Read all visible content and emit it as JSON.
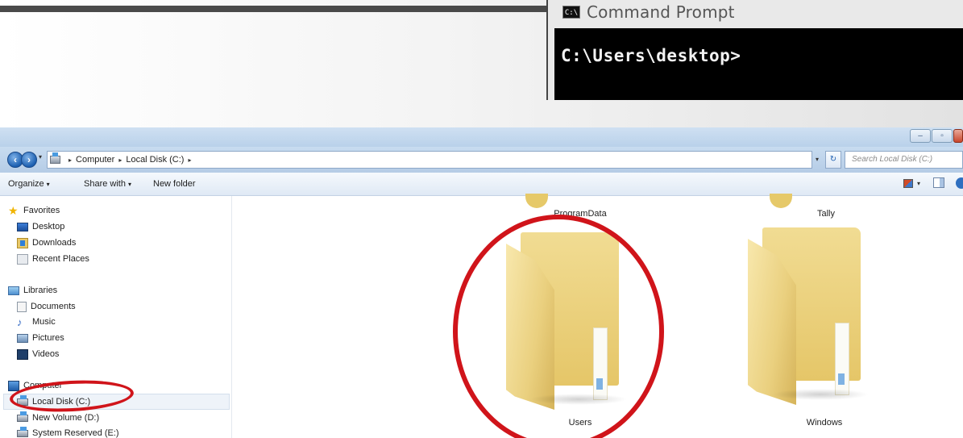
{
  "command_prompt": {
    "title": "Command Prompt",
    "icon": "C:\\",
    "line": "C:\\Users\\desktop>"
  },
  "window_controls": {
    "minimize": "–",
    "maximize": "▫",
    "close": ""
  },
  "address_bar": {
    "breadcrumbs": [
      "Computer",
      "Local Disk (C:)"
    ],
    "search_placeholder": "Search Local Disk (C:)"
  },
  "toolbar": {
    "organize_label": "Organize",
    "share_label": "Share with",
    "new_folder_label": "New folder"
  },
  "nav_pane": {
    "favorites": {
      "label": "Favorites",
      "items": [
        {
          "label": "Desktop",
          "icon": "desktop-icon"
        },
        {
          "label": "Downloads",
          "icon": "downloads-icon"
        },
        {
          "label": "Recent Places",
          "icon": "recent-places-icon"
        }
      ]
    },
    "libraries": {
      "label": "Libraries",
      "items": [
        {
          "label": "Documents",
          "icon": "documents-icon"
        },
        {
          "label": "Music",
          "icon": "music-icon"
        },
        {
          "label": "Pictures",
          "icon": "pictures-icon"
        },
        {
          "label": "Videos",
          "icon": "videos-icon"
        }
      ]
    },
    "computer": {
      "label": "Computer",
      "items": [
        {
          "label": "Local Disk (C:)",
          "icon": "disk-icon",
          "selected": true
        },
        {
          "label": "New Volume (D:)",
          "icon": "disk-icon"
        },
        {
          "label": "System Reserved (E:)",
          "icon": "disk-icon"
        }
      ]
    }
  },
  "folders": [
    {
      "name": "ProgramData"
    },
    {
      "name": "Tally"
    },
    {
      "name": "Users"
    },
    {
      "name": "Windows"
    }
  ],
  "colors": {
    "highlight_ring": "#d0141a",
    "folder": "#e5c668",
    "titlebar": "#b9d1ea"
  }
}
